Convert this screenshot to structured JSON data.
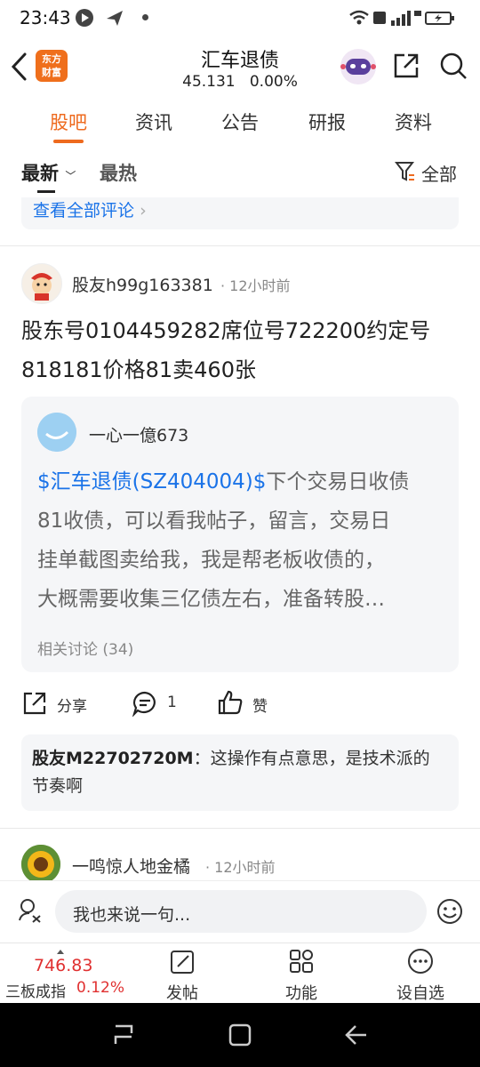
{
  "status_bar": {
    "time": "23:43"
  },
  "header": {
    "title": "汇车退债",
    "price": "45.131",
    "change": "0.00%",
    "logo_text_top": "东方",
    "logo_text_bottom": "财富"
  },
  "tabs": [
    {
      "label": "股吧",
      "active": true
    },
    {
      "label": "资讯",
      "active": false
    },
    {
      "label": "公告",
      "active": false
    },
    {
      "label": "研报",
      "active": false
    },
    {
      "label": "资料",
      "active": false
    }
  ],
  "filters": {
    "latest": "最新",
    "hot": "最热",
    "all": "全部"
  },
  "prev_card": {
    "view_all": "查看全部评论"
  },
  "post": {
    "username": "股友h99g163381",
    "time": "· 12小时前",
    "text_line1": "股东号0104459282席位号722200约定号",
    "text_line2": "818181价格81卖460张",
    "quote": {
      "username": "一心一億673",
      "stock_link": "$汇车退债(SZ404004)$",
      "text_after_link": "下个交易日收债",
      "line2": "81收债，可以看我帖子，留言，交易日",
      "line3": "挂单截图卖给我，我是帮老板收债的，",
      "line4": "大概需要收集三亿债左右，准备转股…",
      "related": "相关讨论 (34)"
    },
    "actions": {
      "share": "分享",
      "comment_count": "1",
      "like": "赞"
    },
    "reply": {
      "user": "股友M22702720M",
      "text_line1": "：这操作有点意思，是技术派的",
      "text_line2": "节奏啊"
    }
  },
  "next_post": {
    "username": "一鸣惊人地金橘",
    "time": "· 12小时前"
  },
  "comment_bar": {
    "placeholder": "我也来说一句..."
  },
  "bottom_nav": {
    "index_value": "746.83",
    "index_name": "三板成指",
    "index_change": "0.12%",
    "post": "发帖",
    "features": "功能",
    "watchlist": "设自选"
  },
  "colors": {
    "accent": "#ee6a1e",
    "link": "#1a73e8",
    "down_red": "#e03030"
  }
}
